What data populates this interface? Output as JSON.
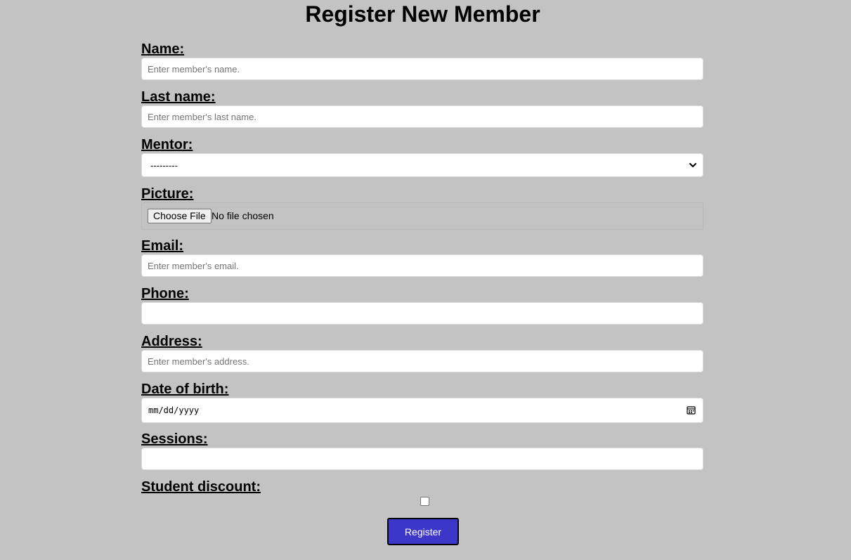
{
  "page": {
    "title": "Register New Member"
  },
  "form": {
    "name": {
      "label": "Name:",
      "placeholder": "Enter member's name.",
      "value": ""
    },
    "last_name": {
      "label": "Last name:",
      "placeholder": "Enter member's last name.",
      "value": ""
    },
    "mentor": {
      "label": "Mentor:",
      "selected": "---------"
    },
    "picture": {
      "label": "Picture:",
      "button_label": "Choose File",
      "status": "No file chosen"
    },
    "email": {
      "label": "Email:",
      "placeholder": "Enter member's email.",
      "value": ""
    },
    "phone": {
      "label": "Phone:",
      "placeholder": "",
      "value": ""
    },
    "address": {
      "label": "Address:",
      "placeholder": "Enter member's address.",
      "value": ""
    },
    "date_of_birth": {
      "label": "Date of birth:",
      "placeholder": "mm/dd/yyyy"
    },
    "sessions": {
      "label": "Sessions:",
      "placeholder": "",
      "value": ""
    },
    "student_discount": {
      "label": "Student discount:",
      "checked": false
    },
    "submit_label": "Register"
  },
  "colors": {
    "background": "#c3c3c3",
    "button_fill": "#3c37c9",
    "button_text": "#ffffff"
  },
  "icons": {
    "mentor_dropdown": "chevron-down-icon",
    "date_picker": "calendar-icon"
  }
}
